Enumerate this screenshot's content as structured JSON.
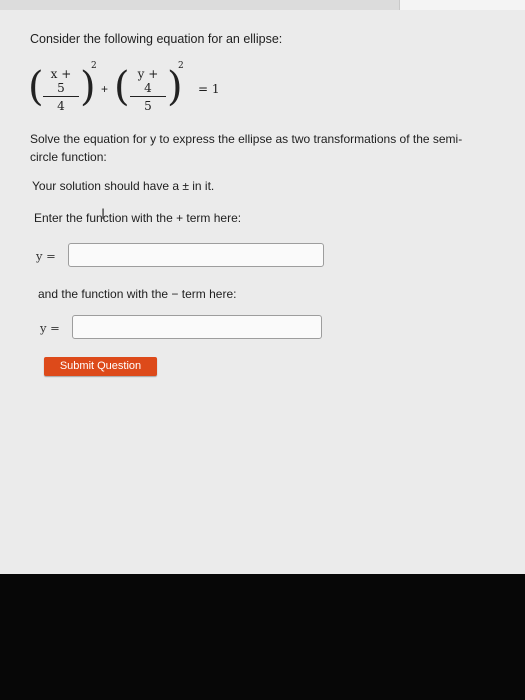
{
  "question": {
    "intro": "Consider the following equation for an ellipse:",
    "equation": {
      "term1_numerator": "x + 5",
      "term1_denominator": "4",
      "term2_numerator": "y + 4",
      "term2_denominator": "5",
      "exponent": "2",
      "plus": "+",
      "rhs": "= 1"
    },
    "instructions_line1": "Solve the equation for y to express the ellipse as two transformations of the semi-",
    "instructions_line2": "circle function:",
    "pm_note": "Your solution should have a ± in it.",
    "plus_prompt": "Enter the function with the + term here:",
    "minus_prompt": "and the function with the − term here:",
    "y_label": "y ="
  },
  "inputs": {
    "plus_term_value": "",
    "minus_term_value": ""
  },
  "submit_label": "Submit Question",
  "colors": {
    "accent": "#dd4a1a",
    "screen_bg": "#ebebeb"
  }
}
